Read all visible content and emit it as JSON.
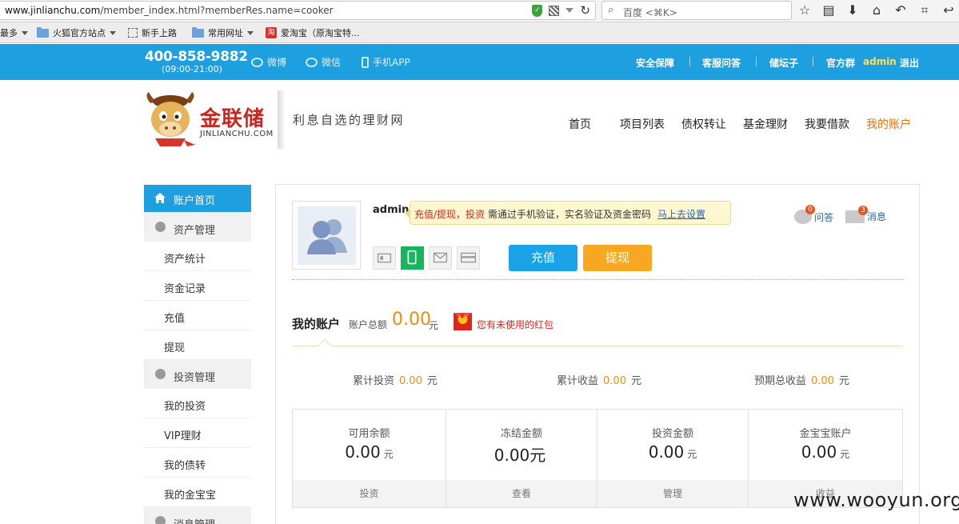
{
  "browser": {
    "url_domain": "www.jinlianchu.com",
    "url_path": "/member_index.html?memberRes.name=cooker",
    "search_placeholder": "百度 <⌘K>",
    "bookmarks": [
      {
        "label": "最多"
      },
      {
        "label": "火狐官方站点"
      },
      {
        "label": "新手上路"
      },
      {
        "label": "常用网址"
      },
      {
        "label": "爱淘宝（原淘宝特..."
      }
    ],
    "tao_icon": "淘"
  },
  "topbar": {
    "phone": "400-858-9882",
    "hours": "(09:00-21:00)",
    "weibo": "微博",
    "weixin": "微信",
    "app": "手机APP",
    "links": [
      "安全保障",
      "客服问答",
      "储坛子",
      "官方群"
    ],
    "user": "admin",
    "logout": "退出"
  },
  "header": {
    "logo_cn": "金联储",
    "logo_en": "JINLIANCHU.COM",
    "slogan": "利息自选的理财网",
    "nav": [
      "首页",
      "项目列表",
      "债权转让",
      "基金理财",
      "我要借款",
      "我的账户"
    ]
  },
  "sidebar": {
    "home": "账户首页",
    "asset_head": "资产管理",
    "asset_items": [
      "资产统计",
      "资金记录",
      "充值",
      "提现"
    ],
    "invest_head": "投资管理",
    "invest_items": [
      "我的投资",
      "VIP理财",
      "我的债转",
      "我的金宝宝"
    ],
    "msg_head": "消息管理"
  },
  "profile": {
    "name": "admin",
    "notice_red": "充值/提现，投资",
    "notice_text": "需通过手机验证，实名验证及资金密码",
    "notice_link": "马上去设置",
    "recharge": "充值",
    "withdraw": "提现",
    "qa_label": "问答",
    "qa_count": "0",
    "msg_label": "消息",
    "msg_count": "3"
  },
  "account": {
    "title": "我的账户",
    "total_label": "账户总额",
    "total_value": "0.00",
    "unit": "元",
    "hongbao_symbol": "¥",
    "hongbao_text": "您有未使用的红包",
    "stats": [
      {
        "label": "累计投资",
        "value": "0.00",
        "unit": "元"
      },
      {
        "label": "累计收益",
        "value": "0.00",
        "unit": "元"
      },
      {
        "label": "预期总收益",
        "value": "0.00",
        "unit": "元"
      }
    ],
    "cells": [
      {
        "label": "可用余额",
        "value": "0.00",
        "unit": "元",
        "action": "投资"
      },
      {
        "label": "冻结金额",
        "value": "0.00元",
        "unit": "",
        "action": "查看"
      },
      {
        "label": "投资金额",
        "value": "0.00",
        "unit": "元",
        "action": "管理"
      },
      {
        "label": "金宝宝账户",
        "value": "0.00",
        "unit": "元",
        "action": "收益"
      }
    ]
  },
  "watermark": "www.wooyun.org",
  "colors": {
    "brand_blue": "#1e9fe0",
    "accent_orange": "#f08c12",
    "active_nav": "#e8711f"
  }
}
